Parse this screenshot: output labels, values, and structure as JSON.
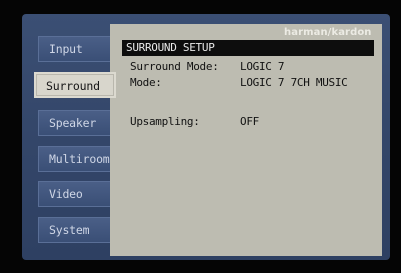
{
  "brand": "harman/kardon",
  "menu": {
    "tabs": [
      {
        "label": "Input",
        "active": false
      },
      {
        "label": "Surround",
        "active": true
      },
      {
        "label": "Speaker",
        "active": false
      },
      {
        "label": "Multiroom",
        "active": false
      },
      {
        "label": "Video",
        "active": false
      },
      {
        "label": "System",
        "active": false
      }
    ]
  },
  "panel": {
    "title": "SURROUND SETUP",
    "rows": [
      {
        "label": "Surround Mode:",
        "value": "LOGIC 7"
      },
      {
        "label": "Mode:",
        "value": "LOGIC 7 7CH MUSIC"
      },
      {
        "label": "Upsampling:",
        "value": "OFF"
      }
    ]
  },
  "colors": {
    "osd_background": "#34476a",
    "tab_background": "#3a4f76",
    "active_tab_background": "#d8d6cc",
    "panel_background": "#bdbcb1",
    "title_bar": "#0d0d0d"
  }
}
